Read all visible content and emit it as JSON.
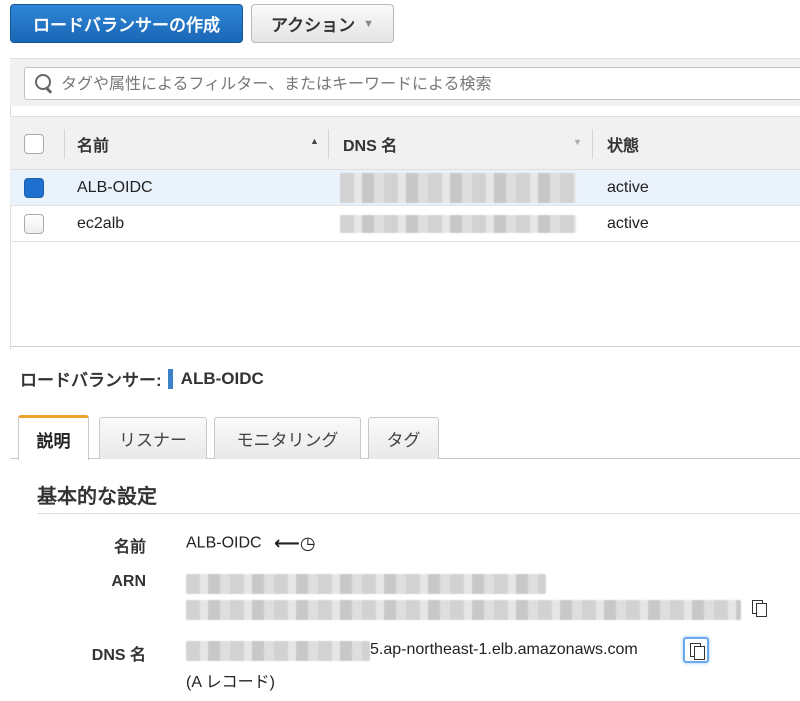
{
  "toolbar": {
    "create_label": "ロードバランサーの作成",
    "actions_label": "アクション",
    "actions_caret": "▼"
  },
  "search": {
    "placeholder": "タグや属性によるフィルター、またはキーワードによる検索"
  },
  "table": {
    "columns": {
      "name": "名前",
      "dns": "DNS 名",
      "state": "状態"
    },
    "sort_up": "▲",
    "sort_down": "▼",
    "rows": [
      {
        "name": "ALB-OIDC",
        "state": "active",
        "selected": true
      },
      {
        "name": "ec2alb",
        "state": "active",
        "selected": false
      }
    ]
  },
  "detail": {
    "title_label": "ロードバランサー:",
    "title_value": "ALB-OIDC",
    "tabs": [
      "説明",
      "リスナー",
      "モニタリング",
      "タグ"
    ],
    "section_title": "基本的な設定",
    "fields": {
      "name_label": "名前",
      "name_value": "ALB-OIDC",
      "history_glyph": "⟵◷",
      "arn_label": "ARN",
      "dns_label": "DNS 名",
      "dns_value_suffix": "5.ap-northeast-1.elb.amazonaws.com",
      "dns_record_type": "(A レコード)"
    }
  },
  "colors": {
    "primary": "#1f6fcf",
    "tab_accent": "#f0a430",
    "title_bar": "#3b82c8"
  }
}
